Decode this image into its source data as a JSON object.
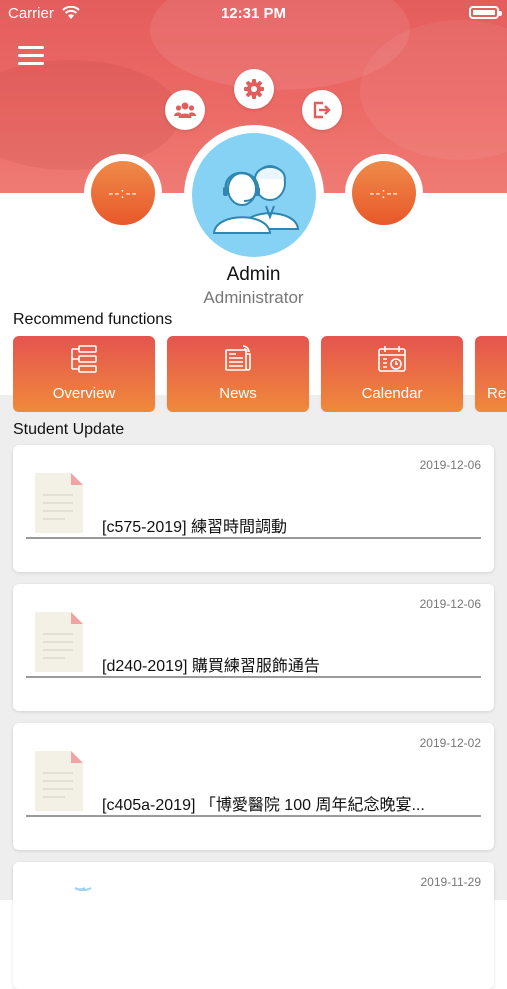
{
  "status_bar": {
    "carrier": "Carrier",
    "time": "12:31 PM"
  },
  "profile": {
    "name": "Admin",
    "role": "Administrator",
    "left_badge": "--:--",
    "right_badge": "--:--"
  },
  "icons": {
    "menu": "hamburger-menu-icon",
    "group": "users-group-icon",
    "settings": "gear-icon",
    "logout": "logout-icon"
  },
  "colors": {
    "header": "#e35d5d",
    "accent_orange": "#e8582a",
    "avatar_bg": "#86d2f5",
    "tile_top": "#e5544f",
    "tile_bottom": "#ef8a3a"
  },
  "recommend": {
    "title": "Recommend functions",
    "items": [
      {
        "label": "Overview",
        "icon": "overview-icon"
      },
      {
        "label": "News",
        "icon": "news-icon"
      },
      {
        "label": "Calendar",
        "icon": "calendar-icon"
      },
      {
        "label": "Re",
        "icon": ""
      }
    ]
  },
  "student_update": {
    "title": "Student Update",
    "items": [
      {
        "date": "2019-12-06",
        "title": "[c575-2019] 練習時間調動"
      },
      {
        "date": "2019-12-06",
        "title": "[d240-2019] 購買練習服飾通告"
      },
      {
        "date": "2019-12-02",
        "title": "[c405a-2019] 「博愛醫院 100 周年紀念晚宴..."
      },
      {
        "date": "2019-11-29",
        "title": ""
      }
    ]
  }
}
